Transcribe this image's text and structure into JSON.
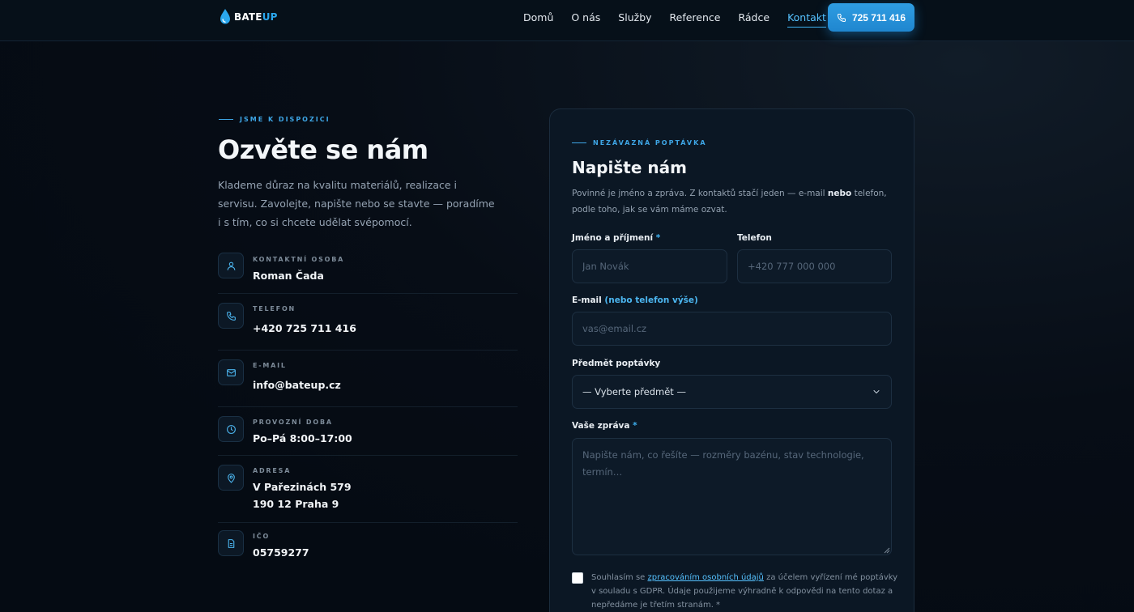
{
  "brand": {
    "name_part1": "BATE",
    "name_part2": "UP",
    "brand_color": "#2aa7ee"
  },
  "nav": {
    "items": [
      {
        "label": "Domů",
        "active": false
      },
      {
        "label": "O nás",
        "active": false
      },
      {
        "label": "Služby",
        "active": false
      },
      {
        "label": "Reference",
        "active": false
      },
      {
        "label": "Rádce",
        "active": false
      },
      {
        "label": "Kontakt",
        "active": true
      }
    ],
    "phone_button": "725 711 416"
  },
  "left": {
    "eyebrow": "JSME K DISPOZICI",
    "title": "Ozvěte se nám",
    "lead": "Klademe důraz na kvalitu materiálů, realizace i servisu. Zavolejte, napište nebo se stavte — poradíme i s tím, co si chcete udělat svépomocí.",
    "contacts": [
      {
        "icon": "user-icon",
        "label": "KONTAKTNÍ OSOBA",
        "value": "Roman Čada"
      },
      {
        "icon": "phone-icon",
        "label": "TELEFON",
        "value": "+420 725 711 416"
      },
      {
        "icon": "mail-icon",
        "label": "E-MAIL",
        "value": "info@bateup.cz"
      },
      {
        "icon": "clock-icon",
        "label": "PROVOZNÍ DOBA",
        "value": "Po–Pá 8:00–17:00"
      },
      {
        "icon": "map-pin-icon",
        "label": "ADRESA",
        "value": "V Pařezinách 579",
        "value2": "190 12 Praha 9"
      },
      {
        "icon": "document-icon",
        "label": "IČO",
        "value": "05759277"
      }
    ]
  },
  "form": {
    "eyebrow": "NEZÁVAZNÁ POPTÁVKA",
    "title": "Napište nám",
    "desc_part1": "Povinné je jméno a zpráva. Z kontaktů stačí jeden — e-mail ",
    "desc_bold": "nebo",
    "desc_part2": " telefon, podle toho, jak se vám máme ozvat.",
    "name": {
      "label": "Jméno a příjmení",
      "required": "*",
      "placeholder": "Jan Novák",
      "value": ""
    },
    "phone": {
      "label": "Telefon",
      "placeholder": "+420 777 000 000",
      "value": ""
    },
    "email": {
      "label": "E-mail",
      "hint": "(nebo telefon výše)",
      "placeholder": "vas@email.cz",
      "value": ""
    },
    "subject": {
      "label": "Předmět poptávky",
      "selected": "— Vyberte předmět —"
    },
    "message": {
      "label": "Vaše zpráva",
      "required": "*",
      "placeholder": "Napište nám, co řešíte — rozměry bazénu, stav technologie, termín…",
      "value": ""
    },
    "consent": {
      "checked": false,
      "text_before": "Souhlasím se ",
      "link": "zpracováním osobních údajů",
      "text_after": " za účelem vyřízení mé poptávky v souladu s GDPR. Údaje použijeme výhradně k odpovědi na tento dotaz a nepředáme je třetím stranám. *"
    }
  },
  "colors": {
    "accent": "#3fb2f2",
    "background": "#050b13",
    "card": "#0b1724"
  }
}
